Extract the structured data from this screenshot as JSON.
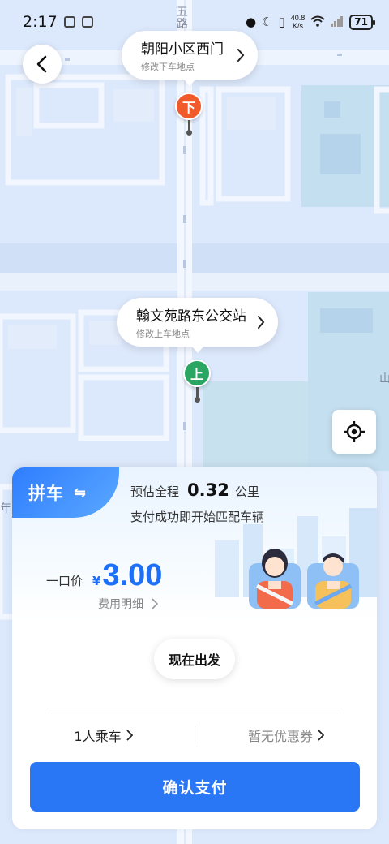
{
  "status_bar": {
    "time": "2:17",
    "net_speed_value": "40.8",
    "net_speed_unit": "K/s",
    "battery": "71"
  },
  "map": {
    "road_label_top": "五路",
    "edge_label_left": "年",
    "edge_label_right": "山"
  },
  "destination": {
    "name": "朝阳小区西门",
    "hint": "修改下车地点",
    "pin_label": "下"
  },
  "pickup": {
    "name": "翰文苑路东公交站",
    "hint": "修改上车地点",
    "pin_label": "上"
  },
  "card": {
    "mode_label": "拼车",
    "swap_symbol": "⇋",
    "estimate_prefix": "预估全程",
    "distance_value": "0.32",
    "distance_unit": "公里",
    "match_note": "支付成功即开始匹配车辆",
    "price_label": "一口价",
    "currency": "¥",
    "price": "3.00",
    "fee_detail": "费用明细",
    "depart_now": "现在出发",
    "passengers": "1人乘车",
    "coupon": "暂无优惠券",
    "confirm_pay": "确认支付"
  },
  "colors": {
    "primary": "#2a77f6",
    "destination_pin": "#f15a2b",
    "pickup_pin": "#2ba662",
    "map_background": "#dce8fb"
  },
  "icons": {
    "back": "chevron-left-icon",
    "locate": "crosshair-icon",
    "chevron": "chevron-right-icon"
  }
}
